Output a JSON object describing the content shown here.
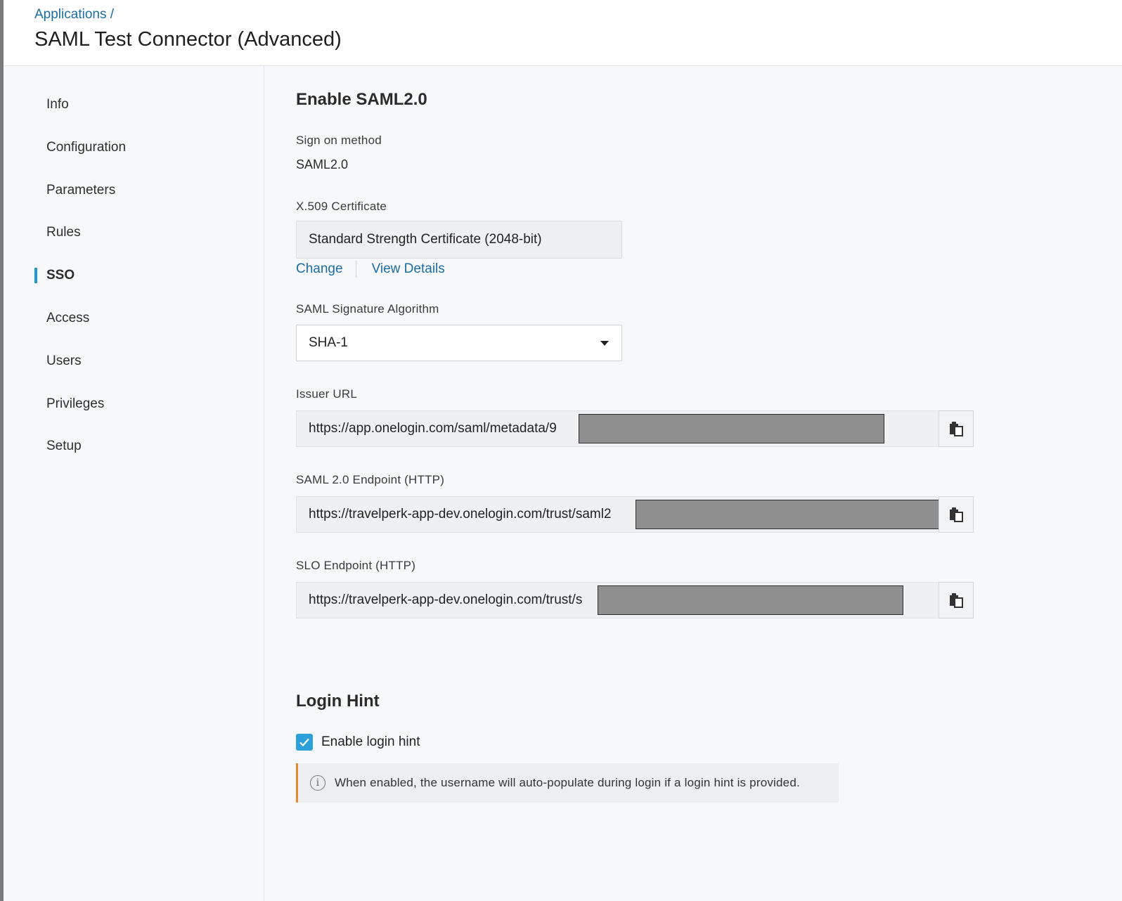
{
  "header": {
    "breadcrumb": "Applications /",
    "title": "SAML Test Connector (Advanced)"
  },
  "sidebar": {
    "items": [
      {
        "label": "Info",
        "active": false
      },
      {
        "label": "Configuration",
        "active": false
      },
      {
        "label": "Parameters",
        "active": false
      },
      {
        "label": "Rules",
        "active": false
      },
      {
        "label": "SSO",
        "active": true
      },
      {
        "label": "Access",
        "active": false
      },
      {
        "label": "Users",
        "active": false
      },
      {
        "label": "Privileges",
        "active": false
      },
      {
        "label": "Setup",
        "active": false
      }
    ]
  },
  "sso": {
    "section_title": "Enable SAML2.0",
    "sign_on_method_label": "Sign on method",
    "sign_on_method_value": "SAML2.0",
    "certificate_label": "X.509 Certificate",
    "certificate_value": "Standard Strength Certificate (2048-bit)",
    "change_link": "Change",
    "view_details_link": "View Details",
    "signature_algorithm_label": "SAML Signature Algorithm",
    "signature_algorithm_value": "SHA-1",
    "issuer_url_label": "Issuer URL",
    "issuer_url_value": "https://app.onelogin.com/saml/metadata/9",
    "saml_endpoint_label": "SAML 2.0 Endpoint (HTTP)",
    "saml_endpoint_value": "https://travelperk-app-dev.onelogin.com/trust/saml2",
    "slo_endpoint_label": "SLO Endpoint (HTTP)",
    "slo_endpoint_value": "https://travelperk-app-dev.onelogin.com/trust/s"
  },
  "login_hint": {
    "section_title": "Login Hint",
    "checkbox_label": "Enable login hint",
    "checkbox_checked": true,
    "notice_text": "When enabled, the username will auto-populate during login if a login hint is provided."
  },
  "colors": {
    "link": "#1a6da2",
    "active_bar": "#1f9ad6",
    "checkbox": "#2d9fd9",
    "notice_accent": "#e58a2e",
    "redaction": "#8f8f8f"
  },
  "icons": {
    "copy": "clipboard-copy-icon",
    "dropdown": "caret-down-icon",
    "checkbox": "checkmark-icon",
    "notice": "info-icon"
  }
}
